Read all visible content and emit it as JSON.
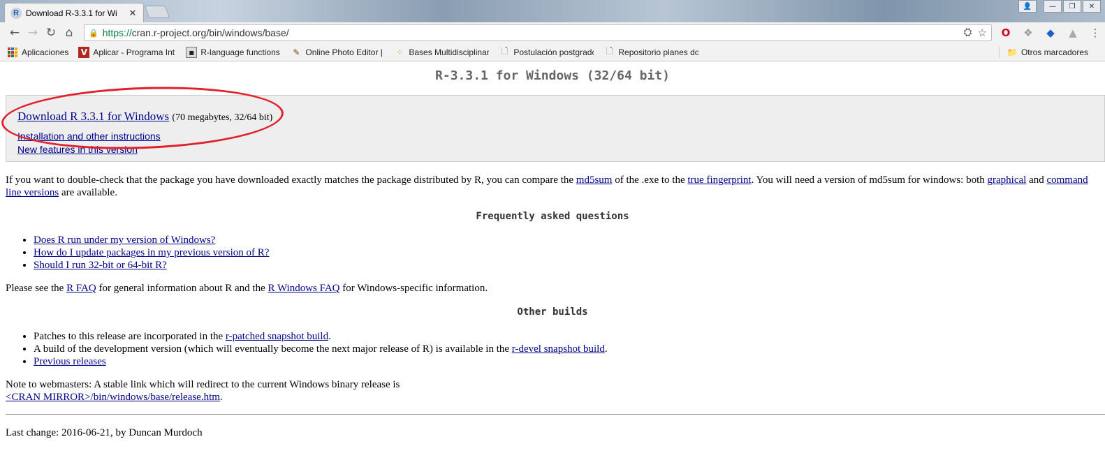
{
  "browser": {
    "tab_title": "Download R-3.3.1 for Wi",
    "tab_favicon": "R",
    "url_scheme": "https://",
    "url_rest": "cran.r-project.org/bin/windows/base/",
    "bookmarks": [
      {
        "label": "Aplicaciones",
        "icon": "apps-icon"
      },
      {
        "label": "Aplicar - Programa Int",
        "icon": "v-logo-icon"
      },
      {
        "label": "R-language functions",
        "icon": "page-icon"
      },
      {
        "label": "Online Photo Editor |",
        "icon": "pencil-icon"
      },
      {
        "label": "Bases Multidisciplinar",
        "icon": "dots-icon"
      },
      {
        "label": "Postulación postgrado",
        "icon": "document-icon"
      },
      {
        "label": "Repositorio planes do",
        "icon": "document-icon"
      }
    ],
    "other_bookmarks": "Otros marcadores"
  },
  "page": {
    "title": "R-3.3.1 for Windows (32/64 bit)",
    "download_link": "Download R 3.3.1 for Windows",
    "download_note": "(70 megabytes, 32/64 bit)",
    "install_link": "Installation and other instructions",
    "new_features_link": "New features in this version",
    "check_p1": "If you want to double-check that the package you have downloaded exactly matches the package distributed by R, you can compare the ",
    "md5sum_link": "md5sum",
    "check_p2": " of the .exe to the ",
    "fingerprint_link": "true fingerprint",
    "check_p3": ". You will need a version of md5sum for windows: both ",
    "graphical_link": "graphical",
    "check_p4": " and ",
    "cmdline_link": "command line versions",
    "check_p5": " are available.",
    "faq_heading": "Frequently asked questions",
    "faq_items": [
      "Does R run under my version of Windows?",
      "How do I update packages in my previous version of R?",
      "Should I run 32-bit or 64-bit R?"
    ],
    "see_p1": "Please see the ",
    "rfaq_link": "R FAQ",
    "see_p2": " for general information about R and the ",
    "rwinfaq_link": "R Windows FAQ",
    "see_p3": " for Windows-specific information.",
    "other_heading": "Other builds",
    "patches_text": "Patches to this release are incorporated in the ",
    "rpatched_link": "r-patched snapshot build",
    "dev_text": "A build of the development version (which will eventually become the next major release of R) is available in the ",
    "rdevel_link": "r-devel snapshot build",
    "previous_link": "Previous releases",
    "webmaster_text": "Note to webmasters: A stable link which will redirect to the current Windows binary release is",
    "mirror_link": "<CRAN MIRROR>/bin/windows/base/release.htm",
    "last_change": "Last change: 2016-06-21, by Duncan Murdoch"
  }
}
